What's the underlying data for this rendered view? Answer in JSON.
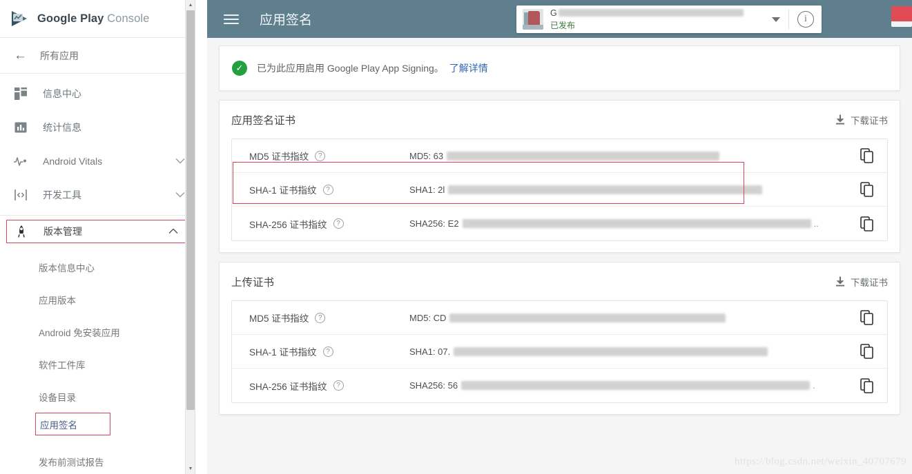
{
  "brand": {
    "logo_icon": "google-play-console-logo",
    "name_bold": "Google Play",
    "name_light": "Console"
  },
  "sidebar": {
    "back": {
      "icon": "back-arrow-icon",
      "label": "所有应用"
    },
    "items": [
      {
        "icon": "dashboard-icon",
        "label": "信息中心",
        "expandable": false
      },
      {
        "icon": "statistics-icon",
        "label": "统计信息",
        "expandable": false
      },
      {
        "icon": "android-vitals-icon",
        "label": "Android Vitals",
        "expandable": true,
        "chevron": "chevron-down"
      },
      {
        "icon": "developer-tools-icon",
        "label": "开发工具",
        "expandable": true,
        "chevron": "chevron-down"
      },
      {
        "icon": "release-management-icon",
        "label": "版本管理",
        "expandable": true,
        "chevron": "chevron-up",
        "active": true
      }
    ],
    "subitems": [
      {
        "label": "版本信息中心",
        "selected": false
      },
      {
        "label": "应用版本",
        "selected": false
      },
      {
        "label": "Android 免安装应用",
        "selected": false
      },
      {
        "label": "软件工件库",
        "selected": false
      },
      {
        "label": "设备目录",
        "selected": false
      },
      {
        "label": "应用签名",
        "selected": true
      },
      {
        "label": "发布前测试报告",
        "selected": false
      }
    ],
    "highlight_color": "#d4455c"
  },
  "topbar": {
    "background": "#5f7f8f",
    "menu_icon": "hamburger-menu-icon",
    "title": "应用签名",
    "app_picker": {
      "app_name_prefix": "G",
      "app_name_redacted": true,
      "status": "已发布",
      "caret_icon": "chevron-down-icon",
      "thumb_icon": "app-thumbnail"
    },
    "info_icon": "info-icon",
    "info_glyph": "i",
    "notifications_icon": "bell-icon",
    "help_icon": "help-icon",
    "avatar_icon": "user-avatar"
  },
  "banner": {
    "status_icon": "success-check-icon",
    "check_glyph": "✓",
    "text": "已为此应用启用 Google Play App Signing。",
    "link": "了解详情",
    "accent": "#23a03f"
  },
  "sections": [
    {
      "title": "应用签名证书",
      "download_label": "下载证书",
      "download_icon": "download-icon",
      "rows": [
        {
          "label": "MD5 证书指纹",
          "help_icon": "help-circle-icon",
          "value_prefix": "MD5: 63",
          "redacted_width": 395,
          "trailing_ellipsis": false,
          "copy_icon": "copy-icon"
        },
        {
          "label": "SHA-1 证书指纹",
          "help_icon": "help-circle-icon",
          "value_prefix": "SHA1: 2l",
          "redacted_width": 455,
          "trailing_ellipsis": false,
          "copy_icon": "copy-icon",
          "annotated": true
        },
        {
          "label": "SHA-256 证书指纹",
          "help_icon": "help-circle-icon",
          "value_prefix": "SHA256: E2",
          "redacted_width": 505,
          "trailing_ellipsis": true,
          "copy_icon": "copy-icon"
        }
      ]
    },
    {
      "title": "上传证书",
      "download_label": "下载证书",
      "download_icon": "download-icon",
      "rows": [
        {
          "label": "MD5 证书指纹",
          "help_icon": "help-circle-icon",
          "value_prefix": "MD5: CD",
          "redacted_width": 400,
          "trailing_ellipsis": false,
          "copy_icon": "copy-icon"
        },
        {
          "label": "SHA-1 证书指纹",
          "help_icon": "help-circle-icon",
          "value_prefix": "SHA1: 07.",
          "redacted_width": 455,
          "trailing_ellipsis": false,
          "copy_icon": "copy-icon"
        },
        {
          "label": "SHA-256 证书指纹",
          "help_icon": "help-circle-icon",
          "value_prefix": "SHA256: 56",
          "redacted_width": 505,
          "trailing_ellipsis": true,
          "copy_icon": "copy-icon"
        }
      ]
    }
  ],
  "help_glyph": "?",
  "watermark": "https://blog.csdn.net/weixin_40707679"
}
